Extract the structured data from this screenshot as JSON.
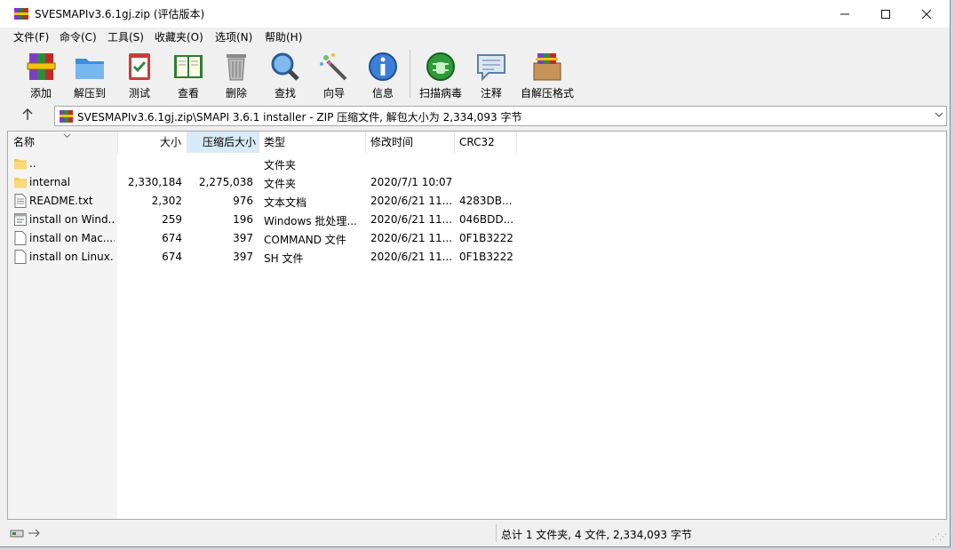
{
  "window": {
    "title": "SVESMAPIv3.6.1gj.zip (评估版本)"
  },
  "menubar": [
    {
      "label": "文件(F)"
    },
    {
      "label": "命令(C)"
    },
    {
      "label": "工具(S)"
    },
    {
      "label": "收藏夹(O)"
    },
    {
      "label": "选项(N)"
    },
    {
      "label": "帮助(H)"
    }
  ],
  "toolbar": [
    {
      "label": "添加",
      "icon": "add-archive-icon"
    },
    {
      "label": "解压到",
      "icon": "extract-folder-icon"
    },
    {
      "label": "测试",
      "icon": "test-clipboard-icon"
    },
    {
      "label": "查看",
      "icon": "view-book-icon"
    },
    {
      "label": "删除",
      "icon": "trash-icon"
    },
    {
      "label": "查找",
      "icon": "magnifier-icon"
    },
    {
      "label": "向导",
      "icon": "wizard-wand-icon"
    },
    {
      "label": "信息",
      "icon": "info-icon"
    },
    {
      "label": "扫描病毒",
      "icon": "virus-scan-icon"
    },
    {
      "label": "注释",
      "icon": "comment-icon"
    },
    {
      "label": "自解压格式",
      "icon": "sfx-box-icon"
    }
  ],
  "address": {
    "path": "SVESMAPIv3.6.1gj.zip\\SMAPI 3.6.1 installer - ZIP 压缩文件, 解包大小为 2,334,093 字节"
  },
  "columns": {
    "name": "名称",
    "size": "大小",
    "packed": "压缩后大小",
    "type": "类型",
    "modified": "修改时间",
    "crc": "CRC32"
  },
  "files": [
    {
      "name": "..",
      "size": "",
      "packed": "",
      "type": "文件夹",
      "modified": "",
      "crc": "",
      "icon": "folder-icon"
    },
    {
      "name": "internal",
      "size": "2,330,184",
      "packed": "2,275,038",
      "type": "文件夹",
      "modified": "2020/7/1 10:07",
      "crc": "",
      "icon": "folder-icon"
    },
    {
      "name": "README.txt",
      "size": "2,302",
      "packed": "976",
      "type": "文本文档",
      "modified": "2020/6/21 11...",
      "crc": "4283DB...",
      "icon": "text-file-icon"
    },
    {
      "name": "install on Wind...",
      "size": "259",
      "packed": "196",
      "type": "Windows 批处理...",
      "modified": "2020/6/21 11...",
      "crc": "046BDD...",
      "icon": "batch-file-icon"
    },
    {
      "name": "install on Mac....",
      "size": "674",
      "packed": "397",
      "type": "COMMAND 文件",
      "modified": "2020/6/21 11...",
      "crc": "0F1B3222",
      "icon": "blank-file-icon"
    },
    {
      "name": "install on Linux....",
      "size": "674",
      "packed": "397",
      "type": "SH 文件",
      "modified": "2020/6/21 11...",
      "crc": "0F1B3222",
      "icon": "blank-file-icon"
    }
  ],
  "status": {
    "summary": "总计 1 文件夹, 4 文件, 2,334,093 字节"
  },
  "colors": {
    "sorted_header": "#d9ebf9",
    "folder": "#f5c95b",
    "window_bg": "#f0f0f0"
  }
}
